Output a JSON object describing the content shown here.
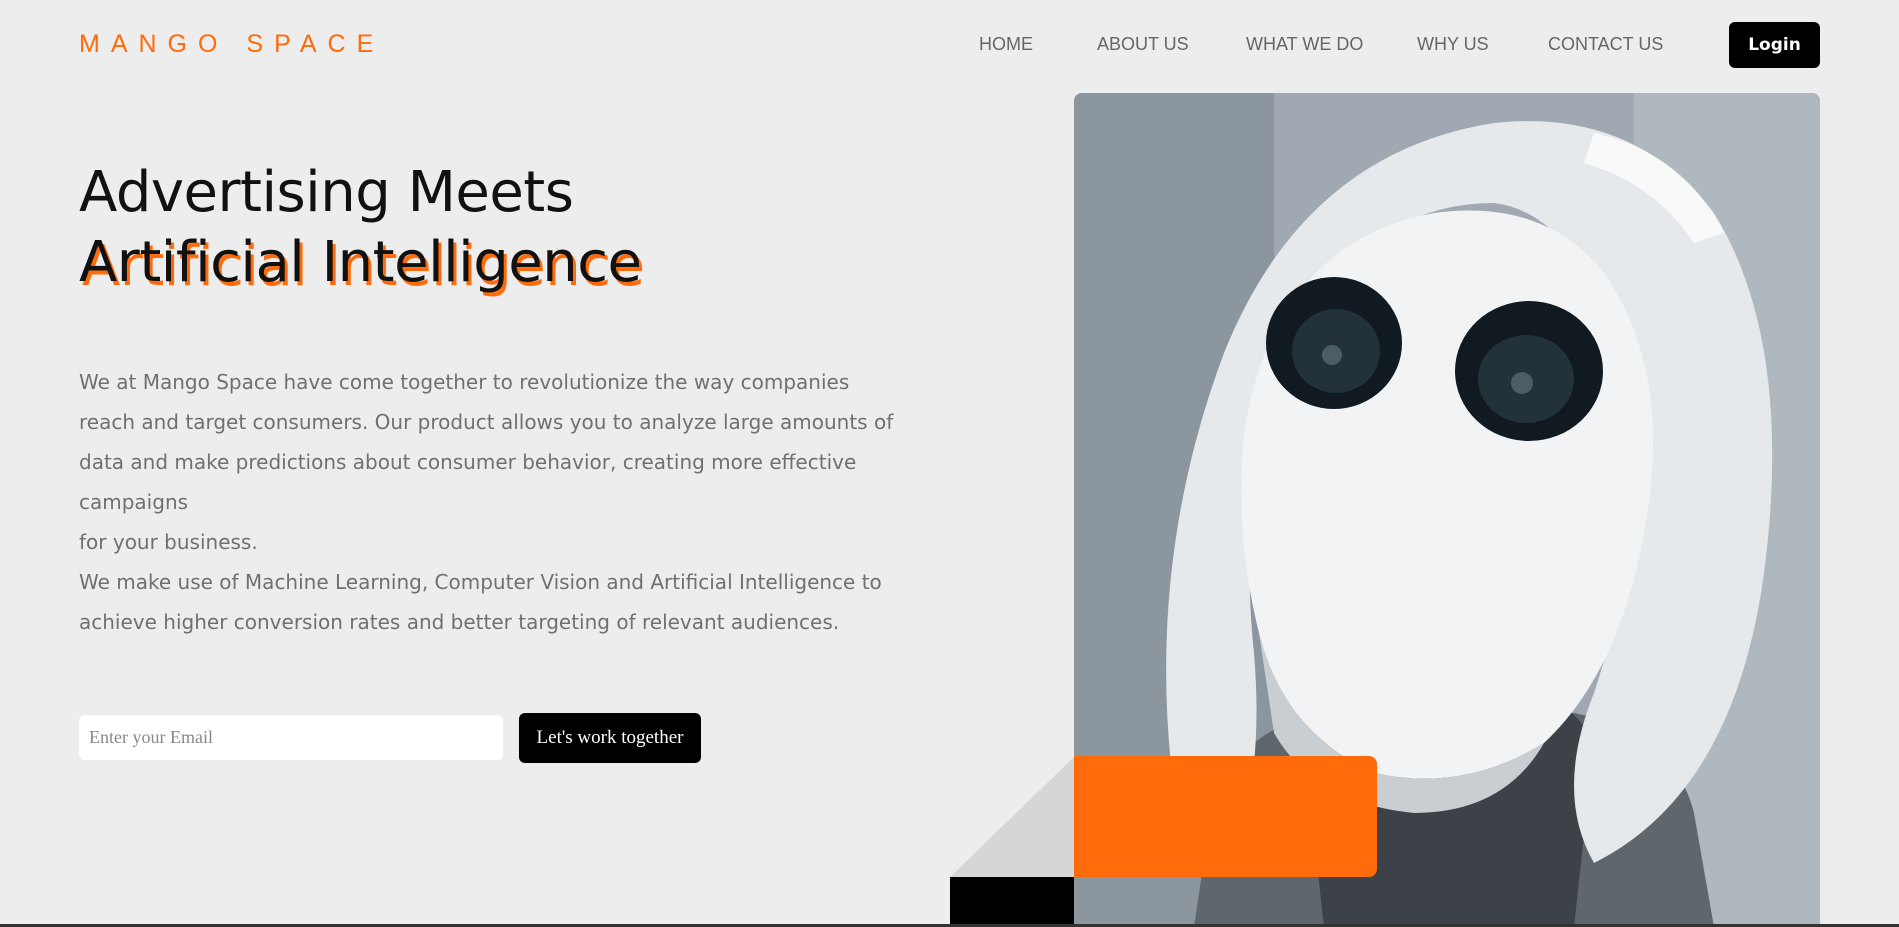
{
  "brand": {
    "logo_text": "MANGO SPACE",
    "accent": "#ff6b0a"
  },
  "nav": {
    "home": "HOME",
    "about": "ABOUT US",
    "what": "WHAT WE DO",
    "why": "WHY US",
    "contact": "CONTACT US",
    "login": "Login"
  },
  "hero": {
    "headline_line1": "Advertising Meets",
    "headline_line2": "Artificial Intelligence",
    "paragraph_lines": [
      "We at Mango Space have come together to revolutionize the way companies",
      "reach and target consumers. Our product allows you to analyze large amounts of",
      "data and make predictions about consumer behavior, creating more effective",
      "campaigns",
      "for your business.",
      "We make use of Machine Learning, Computer Vision and Artificial Intelligence to",
      "achieve higher conversion rates and better targeting of relevant audiences."
    ],
    "email_placeholder": "Enter your Email",
    "email_value": "",
    "cta_label": "Let's work together",
    "image_icon": "robot-photo"
  }
}
